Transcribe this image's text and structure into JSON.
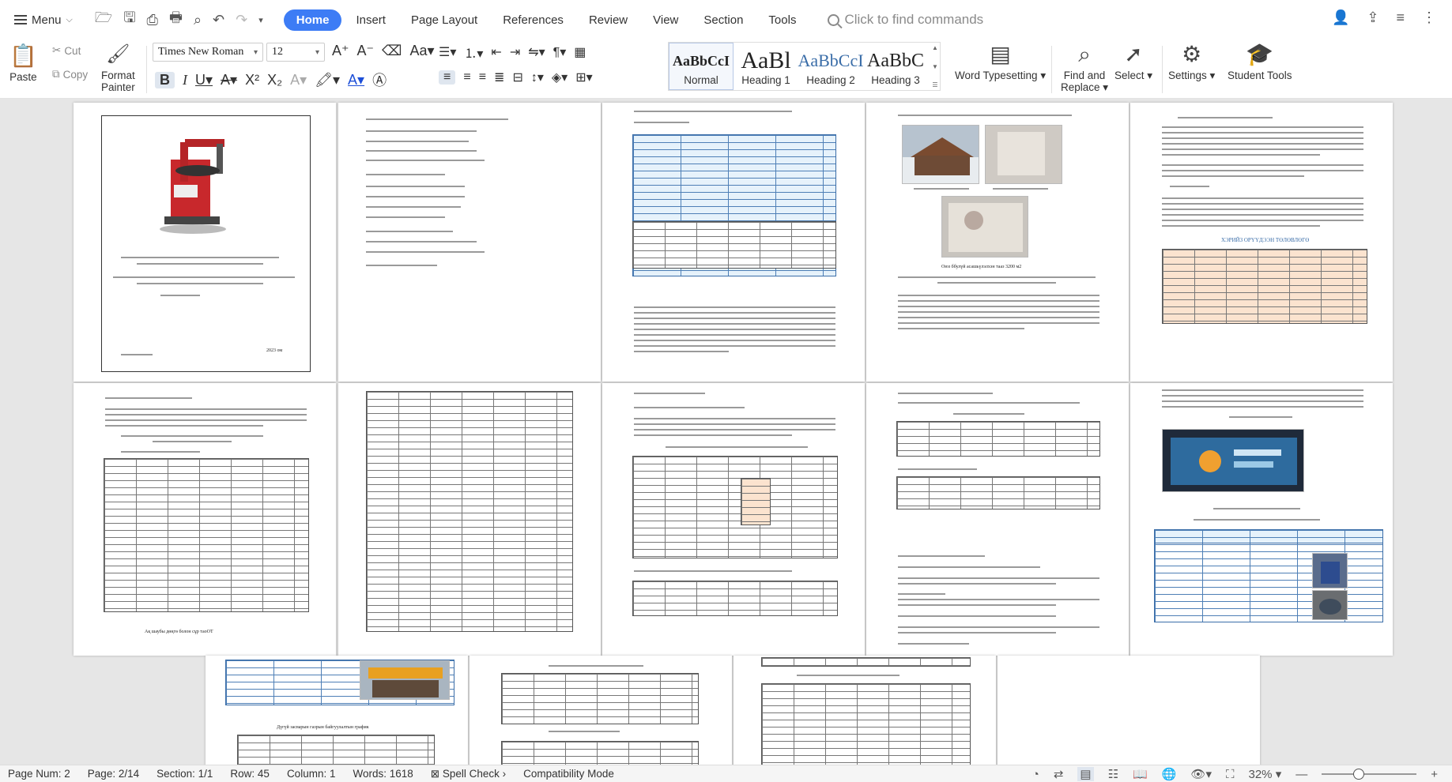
{
  "menu": {
    "label": "Menu"
  },
  "tabs": [
    {
      "label": "Home"
    },
    {
      "label": "Insert"
    },
    {
      "label": "Page Layout"
    },
    {
      "label": "References"
    },
    {
      "label": "Review"
    },
    {
      "label": "View"
    },
    {
      "label": "Section"
    },
    {
      "label": "Tools"
    }
  ],
  "search": {
    "placeholder": "Click to find commands"
  },
  "ribbon": {
    "paste": "Paste",
    "cut": "Cut",
    "copy": "Copy",
    "format_painter_1": "Format",
    "format_painter_2": "Painter",
    "font_name": "Times New Roman",
    "font_size": "12",
    "styles": [
      {
        "preview": "AaBbCcI",
        "label": "Normal"
      },
      {
        "preview": "AaBl",
        "label": "Heading 1"
      },
      {
        "preview": "AaBbCcI",
        "label": "Heading 2"
      },
      {
        "preview": "AaBbC",
        "label": "Heading 3"
      }
    ],
    "word_typesetting": "Word Typesetting",
    "find_replace_1": "Find and",
    "find_replace_2": "Replace",
    "select": "Select",
    "settings": "Settings",
    "student_tools": "Student Tools"
  },
  "status": {
    "page_num": "Page Num: 2",
    "page": "Page: 2/14",
    "section": "Section: 1/1",
    "row": "Row: 45",
    "column": "Column: 1",
    "words": "Words: 1618",
    "spell_check": "Spell Check",
    "compat": "Compatibility Mode",
    "zoom": "32%"
  },
  "pages": {
    "p1_year": "2023 ом",
    "p7_caption": "Ақ шаубы дөңгө болон сұр таоОТ",
    "p9_caption": "Оюз ббулүй асашьүлэлхэн тааз 3200 м2",
    "p10_title": "ХЭРИЙЗ ОРҮҮДЭЭН ТӨЛӨВЛӨГӨ",
    "p13_title": "Дүгүй засварын газрын байгуулалтын график"
  },
  "accent": {
    "home_tab": "#3d7cf5",
    "sign_orange": "#e8a020",
    "table_blue": "#e6f2fb"
  }
}
